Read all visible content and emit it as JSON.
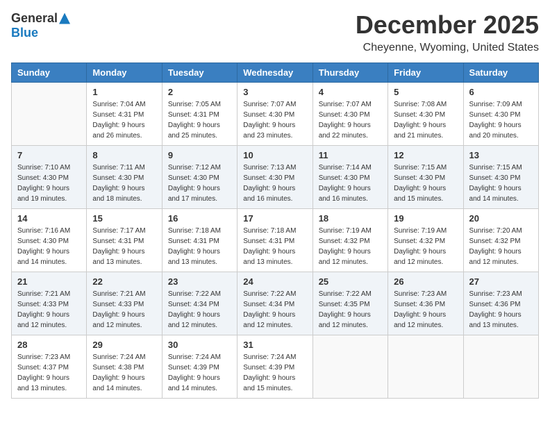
{
  "logo": {
    "general": "General",
    "blue": "Blue"
  },
  "title": "December 2025",
  "location": "Cheyenne, Wyoming, United States",
  "weekdays": [
    "Sunday",
    "Monday",
    "Tuesday",
    "Wednesday",
    "Thursday",
    "Friday",
    "Saturday"
  ],
  "weeks": [
    [
      {
        "day": "",
        "sunrise": "",
        "sunset": "",
        "daylight": ""
      },
      {
        "day": "1",
        "sunrise": "Sunrise: 7:04 AM",
        "sunset": "Sunset: 4:31 PM",
        "daylight": "Daylight: 9 hours and 26 minutes."
      },
      {
        "day": "2",
        "sunrise": "Sunrise: 7:05 AM",
        "sunset": "Sunset: 4:31 PM",
        "daylight": "Daylight: 9 hours and 25 minutes."
      },
      {
        "day": "3",
        "sunrise": "Sunrise: 7:07 AM",
        "sunset": "Sunset: 4:30 PM",
        "daylight": "Daylight: 9 hours and 23 minutes."
      },
      {
        "day": "4",
        "sunrise": "Sunrise: 7:07 AM",
        "sunset": "Sunset: 4:30 PM",
        "daylight": "Daylight: 9 hours and 22 minutes."
      },
      {
        "day": "5",
        "sunrise": "Sunrise: 7:08 AM",
        "sunset": "Sunset: 4:30 PM",
        "daylight": "Daylight: 9 hours and 21 minutes."
      },
      {
        "day": "6",
        "sunrise": "Sunrise: 7:09 AM",
        "sunset": "Sunset: 4:30 PM",
        "daylight": "Daylight: 9 hours and 20 minutes."
      }
    ],
    [
      {
        "day": "7",
        "sunrise": "Sunrise: 7:10 AM",
        "sunset": "Sunset: 4:30 PM",
        "daylight": "Daylight: 9 hours and 19 minutes."
      },
      {
        "day": "8",
        "sunrise": "Sunrise: 7:11 AM",
        "sunset": "Sunset: 4:30 PM",
        "daylight": "Daylight: 9 hours and 18 minutes."
      },
      {
        "day": "9",
        "sunrise": "Sunrise: 7:12 AM",
        "sunset": "Sunset: 4:30 PM",
        "daylight": "Daylight: 9 hours and 17 minutes."
      },
      {
        "day": "10",
        "sunrise": "Sunrise: 7:13 AM",
        "sunset": "Sunset: 4:30 PM",
        "daylight": "Daylight: 9 hours and 16 minutes."
      },
      {
        "day": "11",
        "sunrise": "Sunrise: 7:14 AM",
        "sunset": "Sunset: 4:30 PM",
        "daylight": "Daylight: 9 hours and 16 minutes."
      },
      {
        "day": "12",
        "sunrise": "Sunrise: 7:15 AM",
        "sunset": "Sunset: 4:30 PM",
        "daylight": "Daylight: 9 hours and 15 minutes."
      },
      {
        "day": "13",
        "sunrise": "Sunrise: 7:15 AM",
        "sunset": "Sunset: 4:30 PM",
        "daylight": "Daylight: 9 hours and 14 minutes."
      }
    ],
    [
      {
        "day": "14",
        "sunrise": "Sunrise: 7:16 AM",
        "sunset": "Sunset: 4:30 PM",
        "daylight": "Daylight: 9 hours and 14 minutes."
      },
      {
        "day": "15",
        "sunrise": "Sunrise: 7:17 AM",
        "sunset": "Sunset: 4:31 PM",
        "daylight": "Daylight: 9 hours and 13 minutes."
      },
      {
        "day": "16",
        "sunrise": "Sunrise: 7:18 AM",
        "sunset": "Sunset: 4:31 PM",
        "daylight": "Daylight: 9 hours and 13 minutes."
      },
      {
        "day": "17",
        "sunrise": "Sunrise: 7:18 AM",
        "sunset": "Sunset: 4:31 PM",
        "daylight": "Daylight: 9 hours and 13 minutes."
      },
      {
        "day": "18",
        "sunrise": "Sunrise: 7:19 AM",
        "sunset": "Sunset: 4:32 PM",
        "daylight": "Daylight: 9 hours and 12 minutes."
      },
      {
        "day": "19",
        "sunrise": "Sunrise: 7:19 AM",
        "sunset": "Sunset: 4:32 PM",
        "daylight": "Daylight: 9 hours and 12 minutes."
      },
      {
        "day": "20",
        "sunrise": "Sunrise: 7:20 AM",
        "sunset": "Sunset: 4:32 PM",
        "daylight": "Daylight: 9 hours and 12 minutes."
      }
    ],
    [
      {
        "day": "21",
        "sunrise": "Sunrise: 7:21 AM",
        "sunset": "Sunset: 4:33 PM",
        "daylight": "Daylight: 9 hours and 12 minutes."
      },
      {
        "day": "22",
        "sunrise": "Sunrise: 7:21 AM",
        "sunset": "Sunset: 4:33 PM",
        "daylight": "Daylight: 9 hours and 12 minutes."
      },
      {
        "day": "23",
        "sunrise": "Sunrise: 7:22 AM",
        "sunset": "Sunset: 4:34 PM",
        "daylight": "Daylight: 9 hours and 12 minutes."
      },
      {
        "day": "24",
        "sunrise": "Sunrise: 7:22 AM",
        "sunset": "Sunset: 4:34 PM",
        "daylight": "Daylight: 9 hours and 12 minutes."
      },
      {
        "day": "25",
        "sunrise": "Sunrise: 7:22 AM",
        "sunset": "Sunset: 4:35 PM",
        "daylight": "Daylight: 9 hours and 12 minutes."
      },
      {
        "day": "26",
        "sunrise": "Sunrise: 7:23 AM",
        "sunset": "Sunset: 4:36 PM",
        "daylight": "Daylight: 9 hours and 12 minutes."
      },
      {
        "day": "27",
        "sunrise": "Sunrise: 7:23 AM",
        "sunset": "Sunset: 4:36 PM",
        "daylight": "Daylight: 9 hours and 13 minutes."
      }
    ],
    [
      {
        "day": "28",
        "sunrise": "Sunrise: 7:23 AM",
        "sunset": "Sunset: 4:37 PM",
        "daylight": "Daylight: 9 hours and 13 minutes."
      },
      {
        "day": "29",
        "sunrise": "Sunrise: 7:24 AM",
        "sunset": "Sunset: 4:38 PM",
        "daylight": "Daylight: 9 hours and 14 minutes."
      },
      {
        "day": "30",
        "sunrise": "Sunrise: 7:24 AM",
        "sunset": "Sunset: 4:39 PM",
        "daylight": "Daylight: 9 hours and 14 minutes."
      },
      {
        "day": "31",
        "sunrise": "Sunrise: 7:24 AM",
        "sunset": "Sunset: 4:39 PM",
        "daylight": "Daylight: 9 hours and 15 minutes."
      },
      {
        "day": "",
        "sunrise": "",
        "sunset": "",
        "daylight": ""
      },
      {
        "day": "",
        "sunrise": "",
        "sunset": "",
        "daylight": ""
      },
      {
        "day": "",
        "sunrise": "",
        "sunset": "",
        "daylight": ""
      }
    ]
  ]
}
